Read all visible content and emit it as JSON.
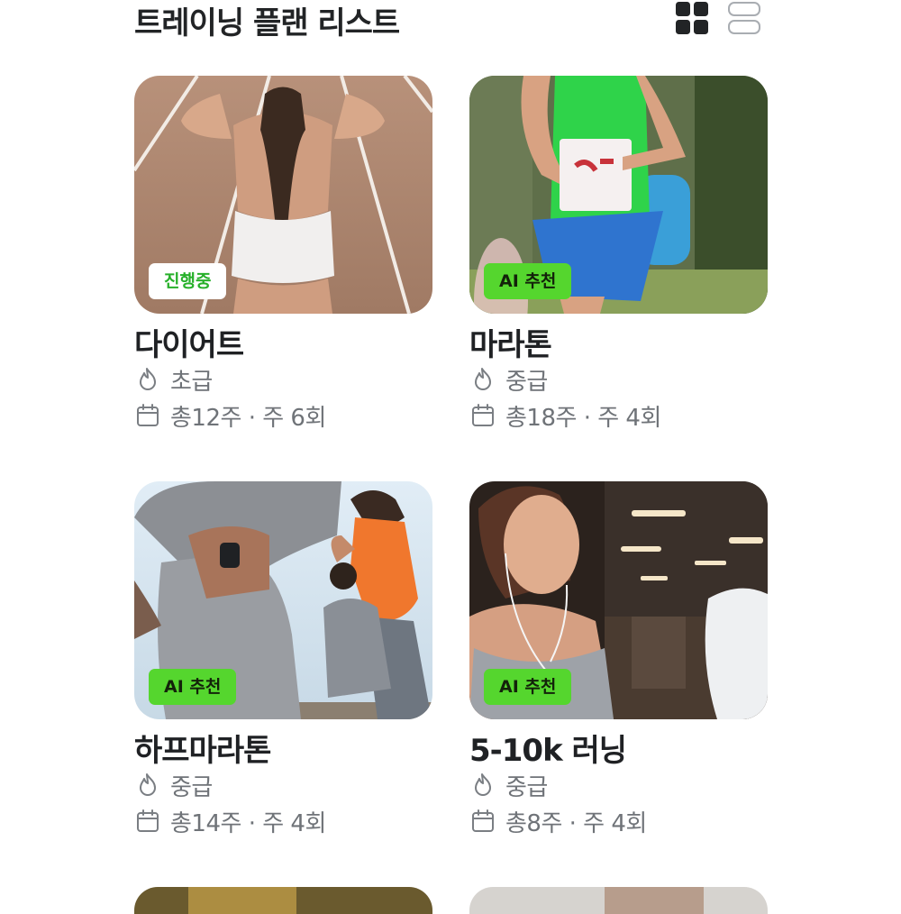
{
  "header": {
    "title": "트레이닝 플랜 리스트",
    "grid_view_icon": "grid-view-icon",
    "list_view_icon": "list-view-icon"
  },
  "plans": [
    {
      "name": "다이어트",
      "badge": "진행중",
      "level_icon": "flame-icon",
      "level": "초급",
      "schedule_icon": "calendar-icon",
      "schedule": "총12주 · 주 6회"
    },
    {
      "name": "마라톤",
      "badge": "AI 추천",
      "level_icon": "flame-icon",
      "level": "중급",
      "schedule_icon": "calendar-icon",
      "schedule": "총18주 · 주 4회"
    },
    {
      "name": "하프마라톤",
      "badge": "AI 추천",
      "level_icon": "flame-icon",
      "level": "중급",
      "schedule_icon": "calendar-icon",
      "schedule": "총14주 · 주 4회"
    },
    {
      "name": "5-10k 러닝",
      "badge": "AI 추천",
      "level_icon": "flame-icon",
      "level": "중급",
      "schedule_icon": "calendar-icon",
      "schedule": "총8주 · 주 4회"
    }
  ],
  "colors": {
    "accent": "#55d62e",
    "progress_text": "#27b02a",
    "title_text": "#1f2124",
    "meta_text": "#6f7378",
    "icon_dark": "#222426"
  }
}
